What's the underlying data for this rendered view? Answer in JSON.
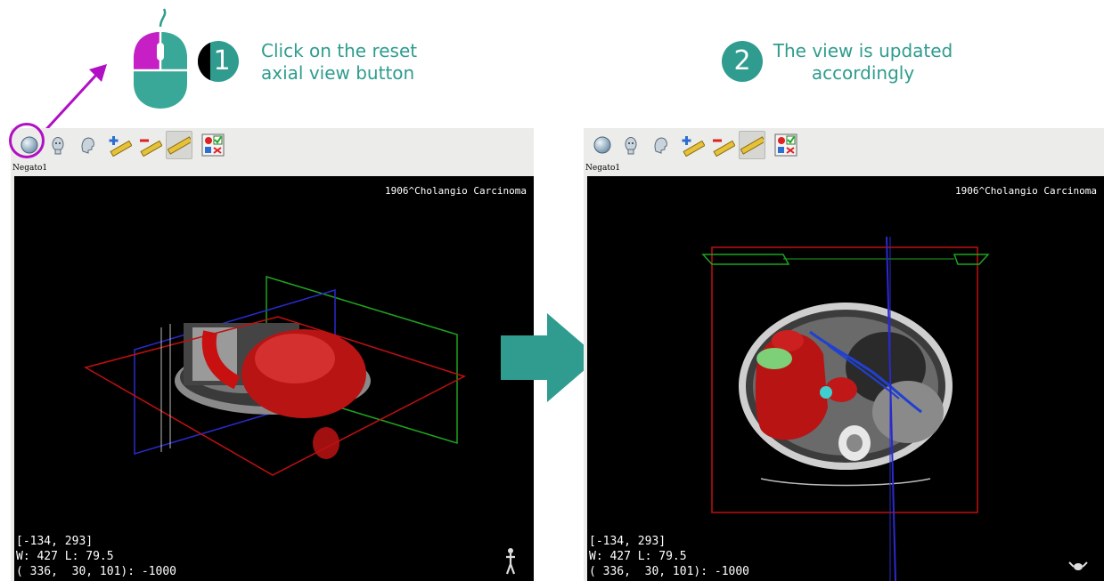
{
  "steps": [
    {
      "number": "1",
      "text_line1": "Click on the reset",
      "text_line2": "axial view button"
    },
    {
      "number": "2",
      "text_line1": "The view is updated",
      "text_line2": "accordingly"
    }
  ],
  "left_panel": {
    "label": "Negato1",
    "patient": "1906^Cholangio Carcinoma",
    "coords": "[-134, 293]",
    "window_level": "W: 427 L: 79.5",
    "voxel": "( 336,  30, 101): -1000"
  },
  "right_panel": {
    "label": "Negato1",
    "patient": "1906^Cholangio Carcinoma",
    "coords": "[-134, 293]",
    "window_level": "W: 427 L: 79.5",
    "voxel": "( 336,  30, 101): -1000"
  },
  "toolbar_icons": [
    "reset-axial-view-icon",
    "reset-frontal-view-icon",
    "reset-sagittal-view-icon",
    "add-distance-icon",
    "remove-distance-icon",
    "distance-visibility-icon",
    "landmarks-icon"
  ],
  "colors": {
    "accent": "#2f9c8f",
    "highlight": "#b10fc4"
  }
}
